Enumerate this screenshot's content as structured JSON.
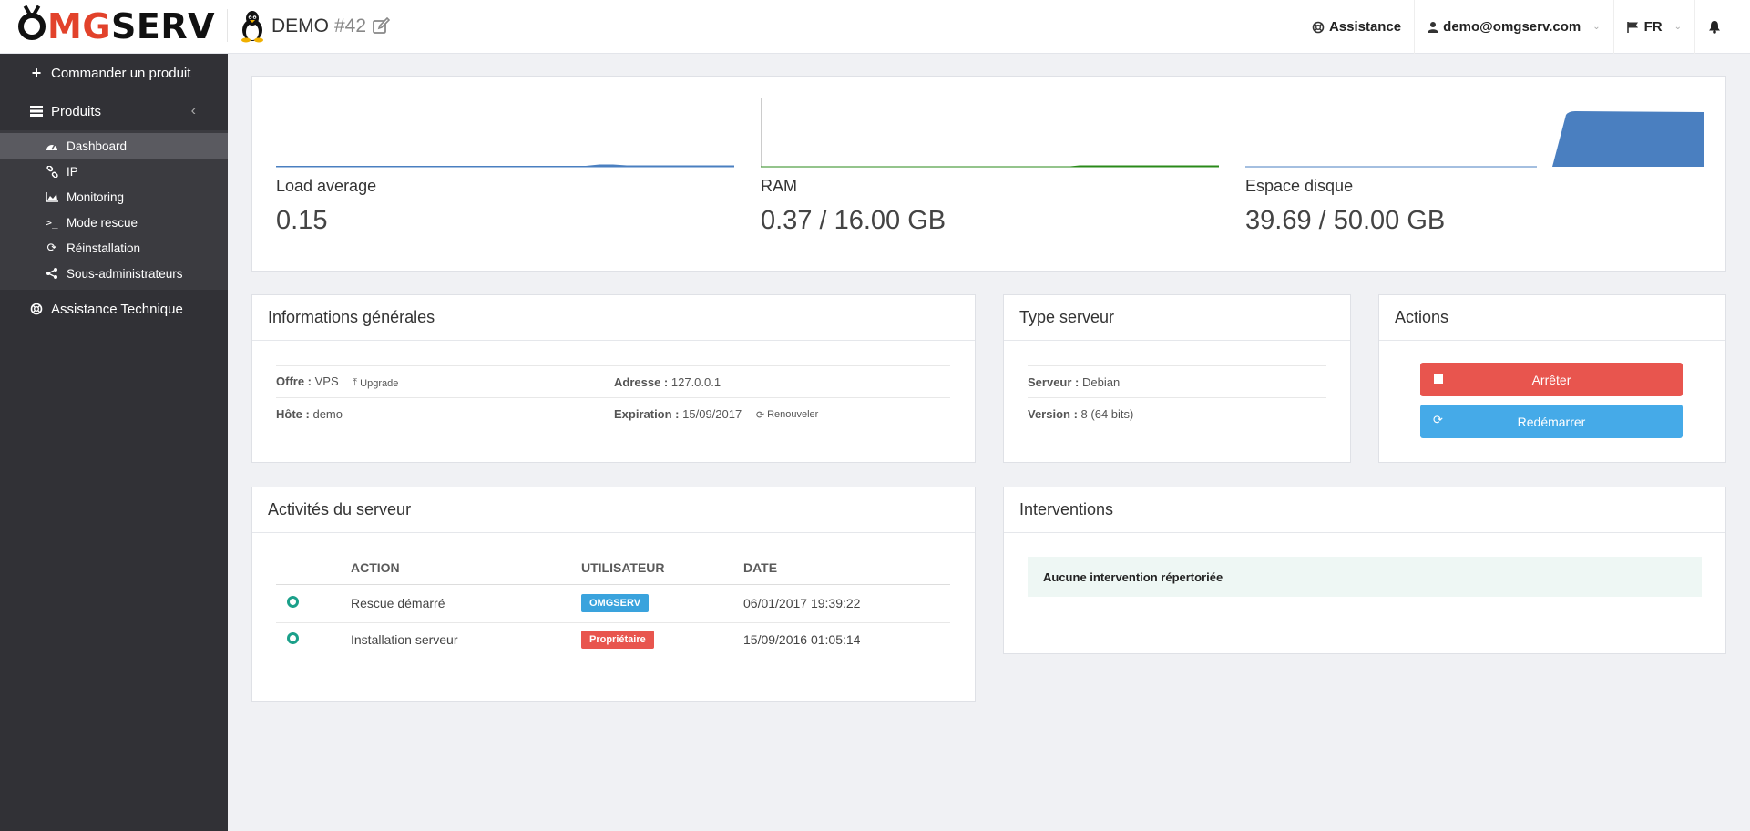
{
  "header": {
    "logo_o": "O",
    "logo_mg": "MG",
    "logo_serv": "SERV",
    "server_name": "DEMO",
    "server_number": "#42",
    "assistance": "Assistance",
    "user_email": "demo@omgserv.com",
    "language": "FR"
  },
  "sidebar": {
    "order_product": "Commander un produit",
    "products": "Produits",
    "items": [
      {
        "label": "Dashboard",
        "icon": "dashboard-icon"
      },
      {
        "label": "IP",
        "icon": "link-icon"
      },
      {
        "label": "Monitoring",
        "icon": "area-chart-icon"
      },
      {
        "label": "Mode rescue",
        "icon": "terminal-icon"
      },
      {
        "label": "Réinstallation",
        "icon": "refresh-icon"
      },
      {
        "label": "Sous-administrateurs",
        "icon": "share-icon"
      }
    ],
    "support": "Assistance Technique"
  },
  "stats": {
    "load_label": "Load average",
    "load_value": "0.15",
    "ram_label": "RAM",
    "ram_value": "0.37 / 16.00 GB",
    "disk_label": "Espace disque",
    "disk_value": "39.69 / 50.00 GB",
    "colors": {
      "load": "#4a7fc0",
      "ram": "#2a8a1a",
      "disk": "#4a7fc0"
    }
  },
  "general_info": {
    "title": "Informations générales",
    "offer_label": "Offre :",
    "offer_value": "VPS",
    "upgrade": "Upgrade",
    "address_label": "Adresse :",
    "address_value": "127.0.0.1",
    "host_label": "Hôte :",
    "host_value": "demo",
    "expiration_label": "Expiration :",
    "expiration_value": "15/09/2017",
    "renew": "Renouveler"
  },
  "server_type": {
    "title": "Type serveur",
    "server_label": "Serveur :",
    "server_value": "Debian",
    "version_label": "Version :",
    "version_value": "8 (64 bits)"
  },
  "actions": {
    "title": "Actions",
    "stop": "Arrêter",
    "restart": "Redémarrer",
    "stop_color": "#e8554e",
    "restart_color": "#45aae8"
  },
  "activities": {
    "title": "Activités du serveur",
    "columns": [
      "ACTION",
      "UTILISATEUR",
      "DATE"
    ],
    "rows": [
      {
        "action": "Rescue démarré",
        "user": "OMGSERV",
        "user_color": "#3aa3dd",
        "date": "06/01/2017 19:39:22"
      },
      {
        "action": "Installation serveur",
        "user": "Propriétaire",
        "user_color": "#e8554e",
        "date": "15/09/2016 01:05:14"
      }
    ]
  },
  "interventions": {
    "title": "Interventions",
    "empty": "Aucune intervention répertoriée"
  }
}
